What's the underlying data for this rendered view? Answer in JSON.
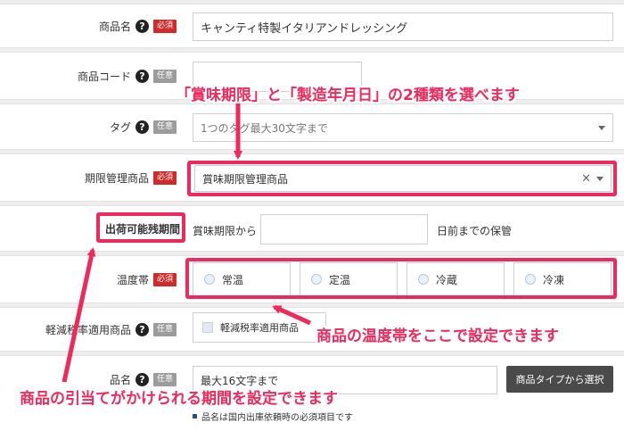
{
  "form": {
    "product_name": {
      "label": "商品名",
      "help": "?",
      "badge": "必須",
      "value": "キャンティ特製イタリアンドレッシング"
    },
    "product_code": {
      "label": "商品コード",
      "help": "?",
      "badge": "任意",
      "value": ""
    },
    "tag": {
      "label": "タグ",
      "help": "?",
      "badge": "任意",
      "placeholder": "1つのタグ最大30文字まで"
    },
    "expiry_management": {
      "label": "期限管理商品",
      "badge": "必須",
      "selected": "賞味期限管理商品",
      "clear": "×"
    },
    "shipping_period": {
      "label": "出荷可能残期間",
      "prefix": "賞味期限から",
      "value": "",
      "suffix": "日前までの保管"
    },
    "temperature": {
      "label": "温度帯",
      "badge": "必須",
      "options": [
        "常温",
        "定温",
        "冷蔵",
        "冷凍"
      ]
    },
    "reduced_tax": {
      "label": "軽減税率適用商品",
      "help": "?",
      "badge": "任意",
      "checkbox_label": "軽減税率適用商品"
    },
    "item_name": {
      "label": "品名",
      "help": "?",
      "badge": "任意",
      "placeholder": "最大16文字まで",
      "button": "商品タイプから選択",
      "note": "品名は国内出庫依頼時の必須項目です"
    }
  },
  "annotations": {
    "expiry_note": "「賞味期限」と「製造年月日」の2種類を選べます",
    "temperature_note": "商品の温度帯をここで設定できます",
    "period_note": "商品の引当てがかけられる期間を設定できます"
  },
  "colors": {
    "required_badge": "#d02a2a",
    "optional_badge": "#9c9c9c",
    "annotation": "#f0295d",
    "button_dark": "#4a4a4a"
  }
}
